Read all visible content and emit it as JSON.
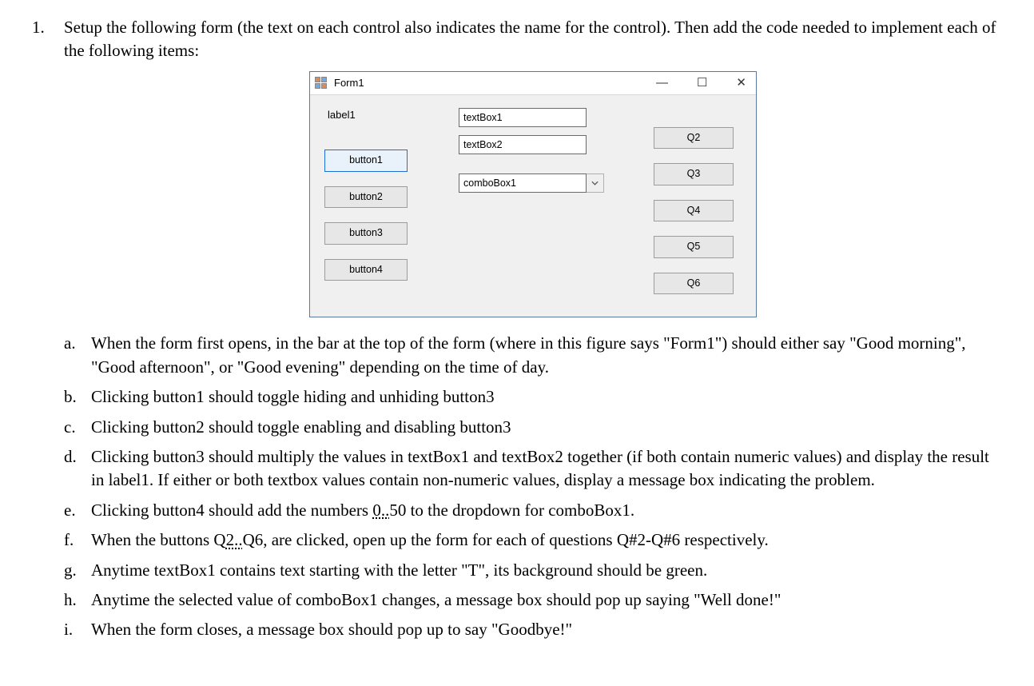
{
  "outer_marker": "1.",
  "intro": "Setup the following form (the text on each control also indicates the name for the control). Then add the code needed to implement each of the following items:",
  "form": {
    "title": "Form1",
    "winbtns": {
      "min": "—",
      "max": "☐",
      "close": "✕"
    },
    "label1": "label1",
    "button1": "button1",
    "button2": "button2",
    "button3": "button3",
    "button4": "button4",
    "textBox1": "textBox1",
    "textBox2": "textBox2",
    "comboBox1": "comboBox1",
    "q2": "Q2",
    "q3": "Q3",
    "q4": "Q4",
    "q5": "Q5",
    "q6": "Q6"
  },
  "items": {
    "a": {
      "mk": "a.",
      "text": "When the form first opens, in the bar at the top of the form (where in this figure says \"Form1\") should either say \"Good morning\", \"Good afternoon\", or \"Good evening\" depending on the time of day."
    },
    "b": {
      "mk": "b.",
      "text": "Clicking button1 should toggle hiding and unhiding button3"
    },
    "c": {
      "mk": "c.",
      "text": "Clicking button2 should toggle enabling and disabling button3"
    },
    "d": {
      "mk": "d.",
      "text": "Clicking button3 should multiply the values in textBox1 and textBox2 together (if both contain numeric values) and display the result in label1. If either or both textbox values contain non-numeric values, display a message box indicating the problem."
    },
    "e": {
      "mk": "e.",
      "pre": "Clicking button4 should add the numbers ",
      "underlined": "0..",
      "post": "50 to the dropdown for comboBox1."
    },
    "f": {
      "mk": "f.",
      "pre": "When the buttons Q",
      "underlined": "2..",
      "post": "Q6, are clicked, open up the form for each of questions Q#2-Q#6 respectively."
    },
    "g": {
      "mk": "g.",
      "text": "Anytime textBox1 contains text starting with the letter \"T\", its background should be green."
    },
    "h": {
      "mk": "h.",
      "text": "Anytime the selected value of comboBox1 changes, a message box should pop up saying \"Well done!\""
    },
    "i": {
      "mk": "i.",
      "text": "When the form closes, a message box should pop up to say \"Goodbye!\""
    }
  }
}
